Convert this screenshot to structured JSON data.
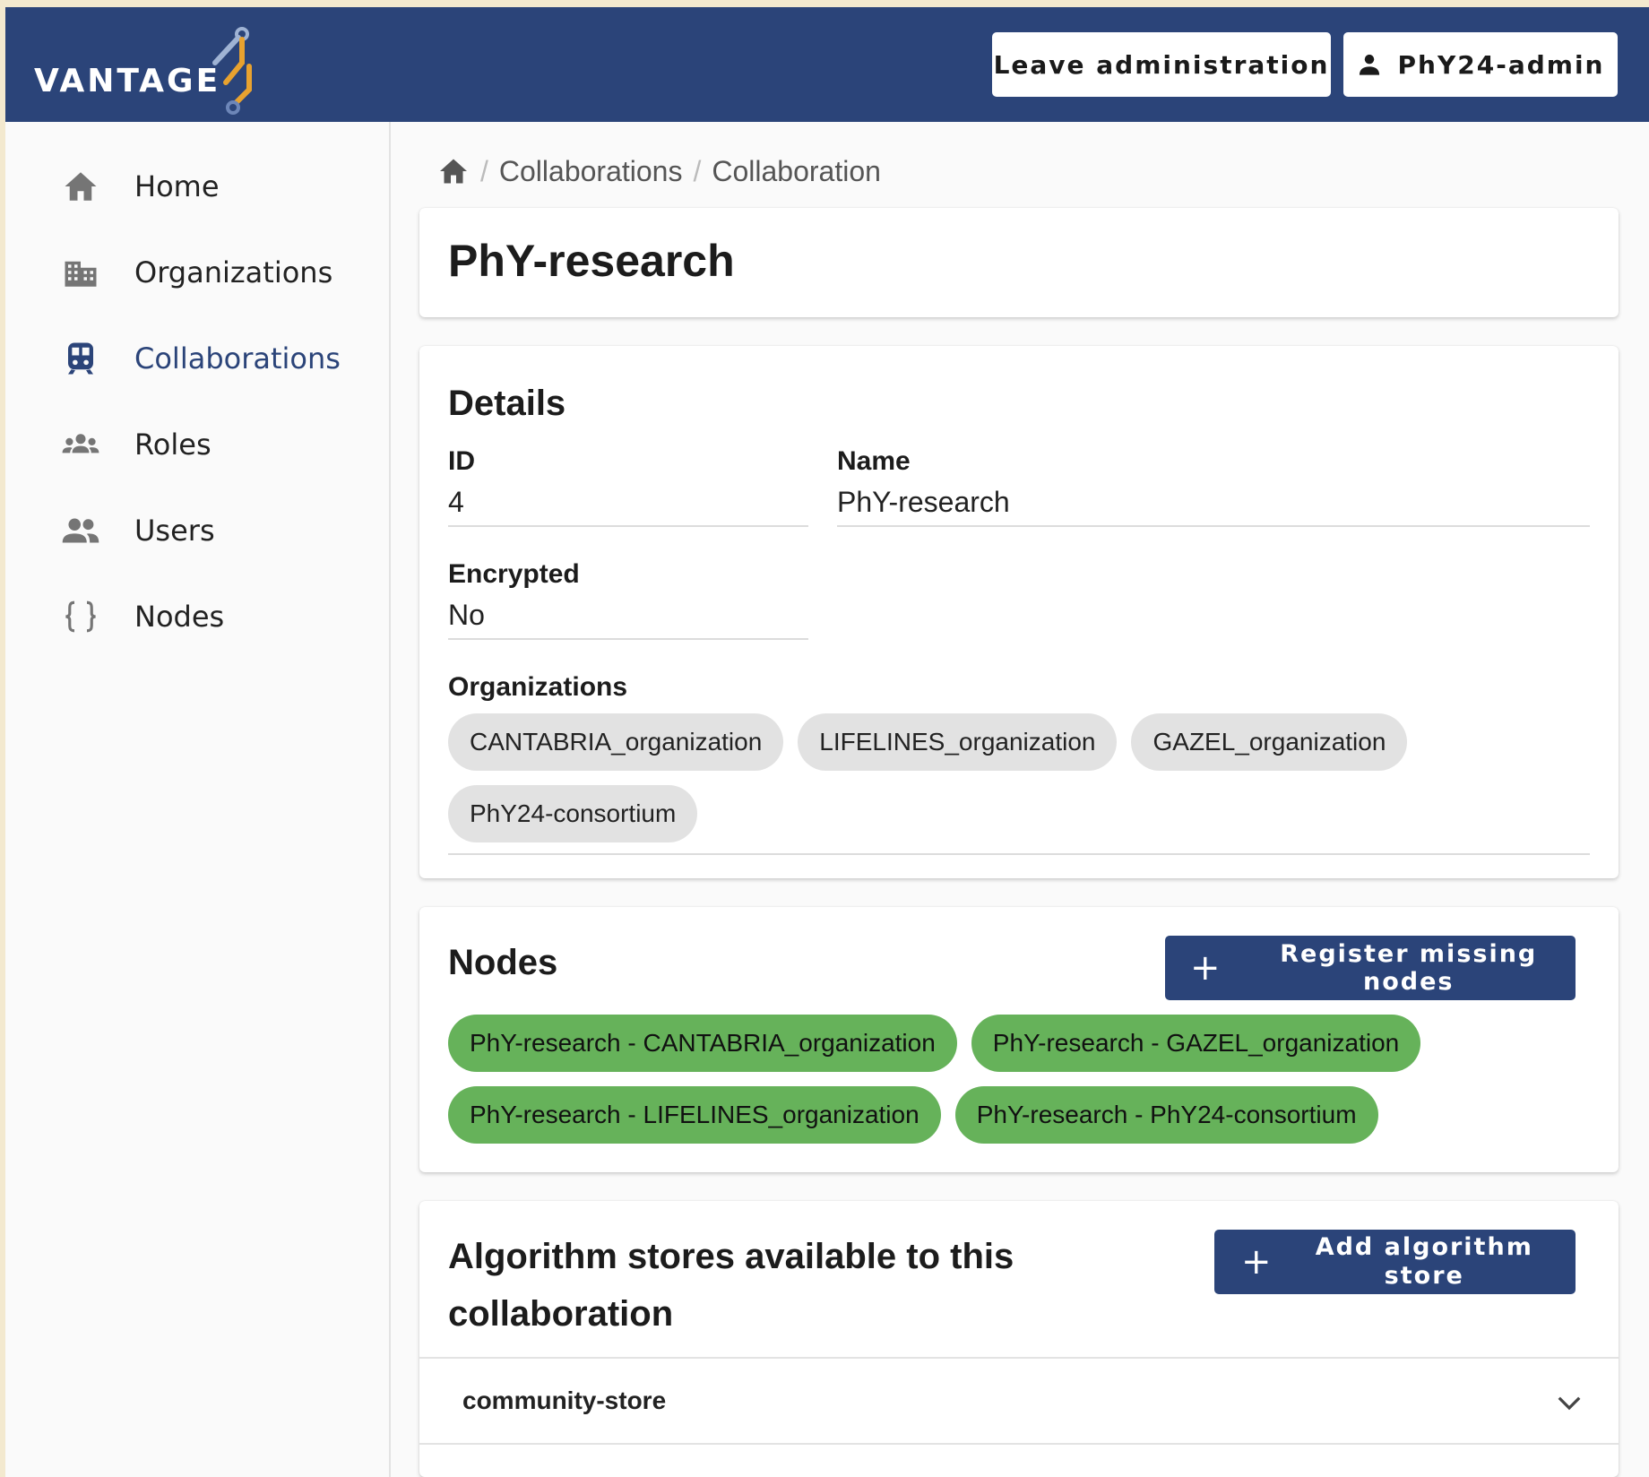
{
  "header": {
    "logo_text": "VANTAGE",
    "leave_label": "Leave administration",
    "user_label": "PhY24-admin",
    "bg_color": "#2b4479"
  },
  "sidebar": {
    "items": [
      {
        "label": "Home",
        "icon": "home-icon"
      },
      {
        "label": "Organizations",
        "icon": "building-icon"
      },
      {
        "label": "Collaborations",
        "icon": "train-icon",
        "active": true
      },
      {
        "label": "Roles",
        "icon": "groups-icon"
      },
      {
        "label": "Users",
        "icon": "people-icon"
      },
      {
        "label": "Nodes",
        "icon": "braces-icon"
      }
    ]
  },
  "breadcrumb": {
    "items": [
      "Collaborations",
      "Collaboration"
    ]
  },
  "page": {
    "title": "PhY-research"
  },
  "details": {
    "title": "Details",
    "id_label": "ID",
    "id_value": "4",
    "name_label": "Name",
    "name_value": "PhY-research",
    "encrypted_label": "Encrypted",
    "encrypted_value": "No",
    "organizations_label": "Organizations",
    "organizations": [
      "CANTABRIA_organization",
      "LIFELINES_organization",
      "GAZEL_organization",
      "PhY24-consortium"
    ]
  },
  "nodes": {
    "title": "Nodes",
    "register_label": "Register missing nodes",
    "items": [
      "PhY-research - CANTABRIA_organization",
      "PhY-research - GAZEL_organization",
      "PhY-research - LIFELINES_organization",
      "PhY-research - PhY24-consortium"
    ],
    "chip_color": "#66b25a"
  },
  "stores": {
    "title_line1": "Algorithm stores available to this",
    "title_line2": "collaboration",
    "add_label_line1": "Add algorithm",
    "add_label_line2": "store",
    "items": [
      "community-store"
    ]
  }
}
